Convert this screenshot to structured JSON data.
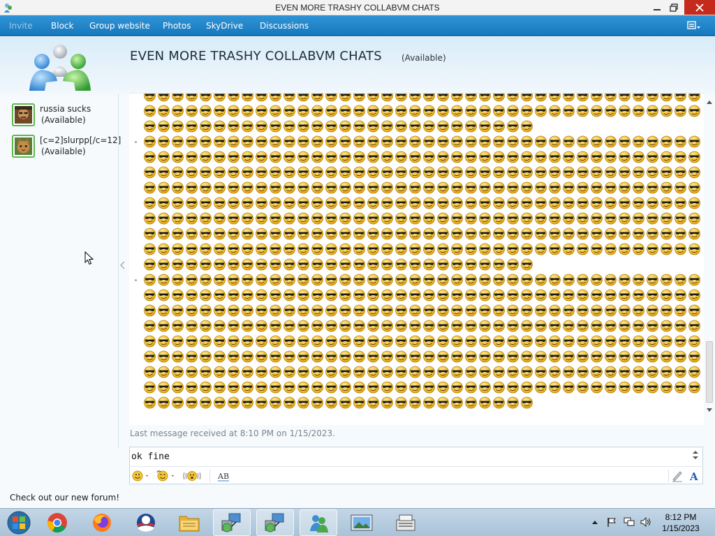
{
  "window": {
    "title": "EVEN MORE TRASHY COLLABVM CHATS"
  },
  "nav": {
    "items": [
      {
        "label": "Invite",
        "disabled": true
      },
      {
        "label": "Block",
        "disabled": false
      },
      {
        "label": "Group website",
        "disabled": false
      },
      {
        "label": "Photos",
        "disabled": false
      },
      {
        "label": "SkyDrive",
        "disabled": false
      },
      {
        "label": "Discussions",
        "disabled": false
      }
    ],
    "menu_icon": "menu-icon"
  },
  "chat": {
    "title": "EVEN MORE TRASHY COLLABVM CHATS",
    "status": "(Available)"
  },
  "contacts": [
    {
      "name": "russia sucks",
      "status": "(Available)"
    },
    {
      "name": "[c=2]slurpp[/c=12]",
      "status": "(Available)"
    }
  ],
  "conversation": {
    "emoticon": "sunglasses-smiley-icon",
    "messages": [
      {
        "full_rows": 2,
        "partial_row": 28
      },
      {
        "full_rows": 8,
        "partial_row": 28
      },
      {
        "full_rows": 8,
        "partial_row": 28
      }
    ]
  },
  "last_message": "Last message received at 8:10 PM on 1/15/2023.",
  "input": {
    "value": "ok fine"
  },
  "footer": {
    "forum_link": "Check out our new forum!"
  },
  "taskbar": {
    "time": "8:12 PM",
    "date": "1/15/2023",
    "apps": [
      "start-orb-icon",
      "chrome-icon",
      "firefox-icon",
      "obama-icon",
      "folder-icon",
      "network-icon",
      "network-icon",
      "messenger-icon",
      "photo-viewer-icon",
      "cash-register-icon"
    ]
  },
  "colors": {
    "accent": "#1e88cf",
    "available": "#5ab94a"
  }
}
